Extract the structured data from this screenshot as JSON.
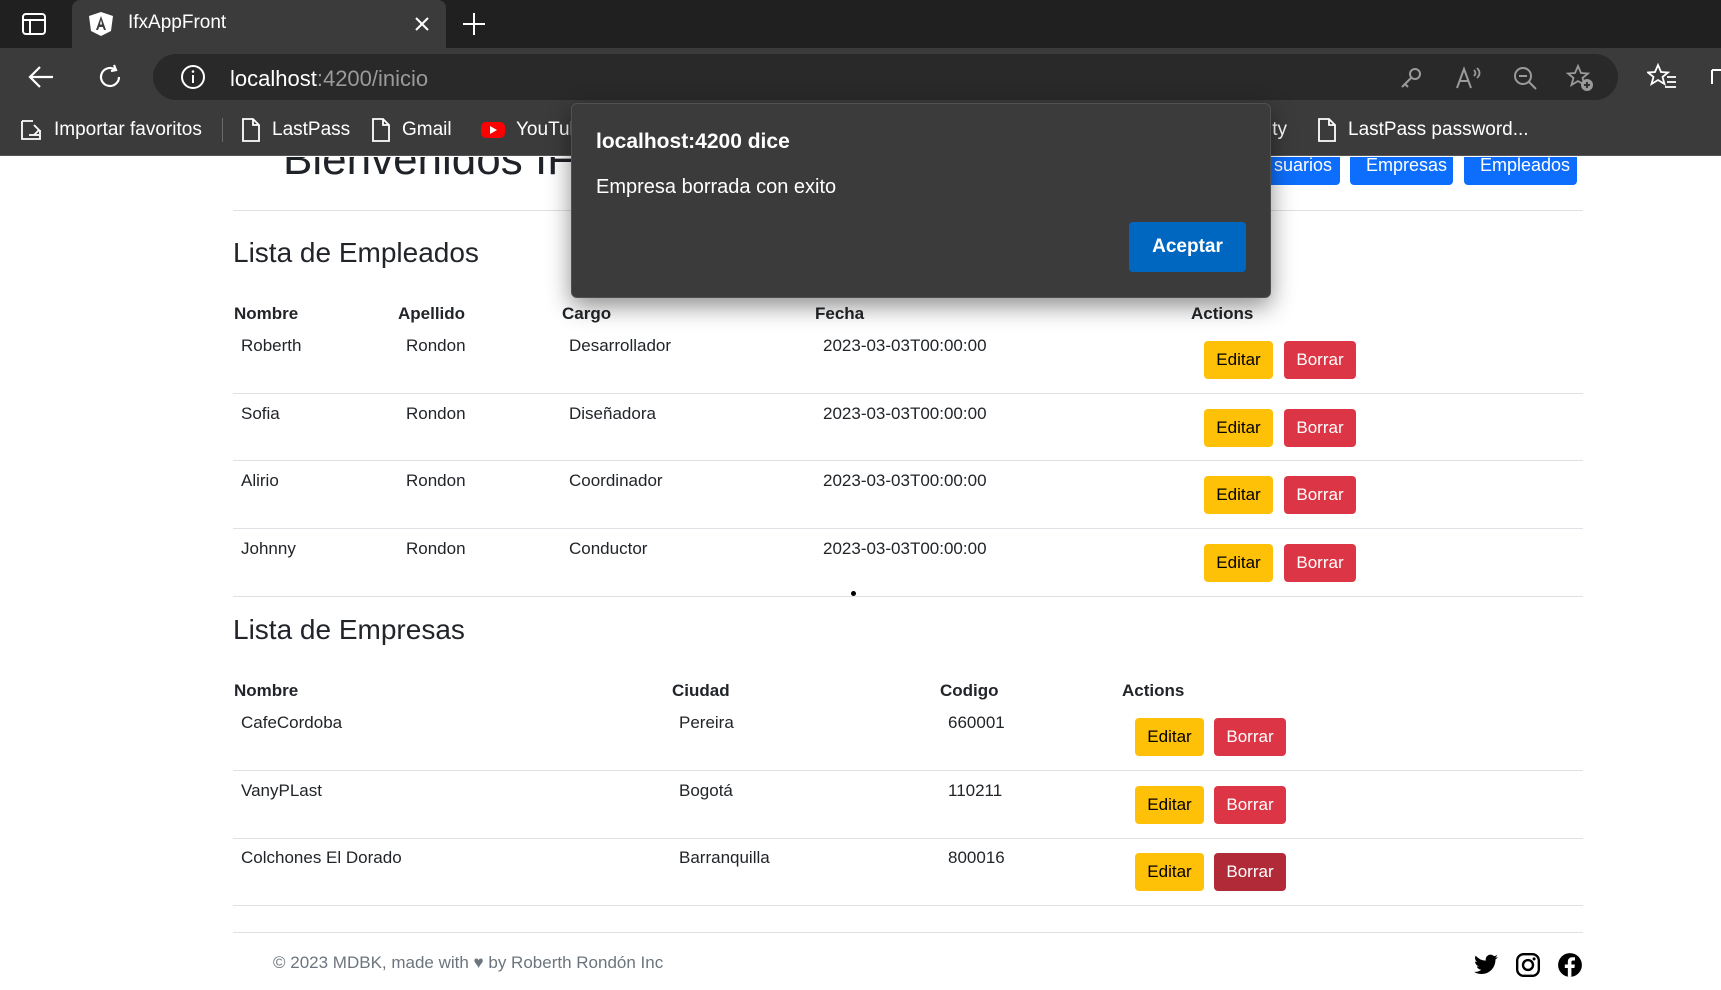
{
  "browser": {
    "tab_title": "IfxAppFront",
    "url_host": "localhost",
    "url_rest": ":4200/inicio",
    "bookmarks": [
      "Importar favoritos",
      "LastPass",
      "Gmail",
      "YouTul",
      "ity",
      "LastPass password..."
    ]
  },
  "page": {
    "hero_title": "Bienvenidos IFX",
    "nav_buttons": [
      "suarios",
      "Empresas",
      "Empleados"
    ]
  },
  "empleados": {
    "title": "Lista de Empleados",
    "headers": [
      "Nombre",
      "Apellido",
      "Cargo",
      "Fecha",
      "Actions"
    ],
    "rows": [
      {
        "nombre": "Roberth",
        "apellido": "Rondon",
        "cargo": "Desarrollador",
        "fecha": "2023-03-03T00:00:00"
      },
      {
        "nombre": "Sofia",
        "apellido": "Rondon",
        "cargo": "Diseñadora",
        "fecha": "2023-03-03T00:00:00"
      },
      {
        "nombre": "Alirio",
        "apellido": "Rondon",
        "cargo": "Coordinador",
        "fecha": "2023-03-03T00:00:00"
      },
      {
        "nombre": "Johnny",
        "apellido": "Rondon",
        "cargo": "Conductor",
        "fecha": "2023-03-03T00:00:00"
      }
    ]
  },
  "empresas": {
    "title": "Lista de Empresas",
    "headers": [
      "Nombre",
      "Ciudad",
      "Codigo",
      "Actions"
    ],
    "rows": [
      {
        "nombre": "CafeCordoba",
        "ciudad": "Pereira",
        "codigo": "660001"
      },
      {
        "nombre": "VanyPLast",
        "ciudad": "Bogotá",
        "codigo": "110211"
      },
      {
        "nombre": "Colchones El Dorado",
        "ciudad": "Barranquilla",
        "codigo": "800016"
      }
    ]
  },
  "buttons": {
    "edit": "Editar",
    "delete": "Borrar"
  },
  "footer": {
    "text": "© 2023 MDBK, made with ♥ by Roberth Rondón Inc"
  },
  "dialog": {
    "title": "localhost:4200 dice",
    "message": "Empresa borrada con exito",
    "ok": "Aceptar"
  },
  "colors": {
    "primary": "#0d6efd",
    "warning": "#ffc107",
    "danger": "#dc3545",
    "dialog_button": "#0067c0"
  }
}
